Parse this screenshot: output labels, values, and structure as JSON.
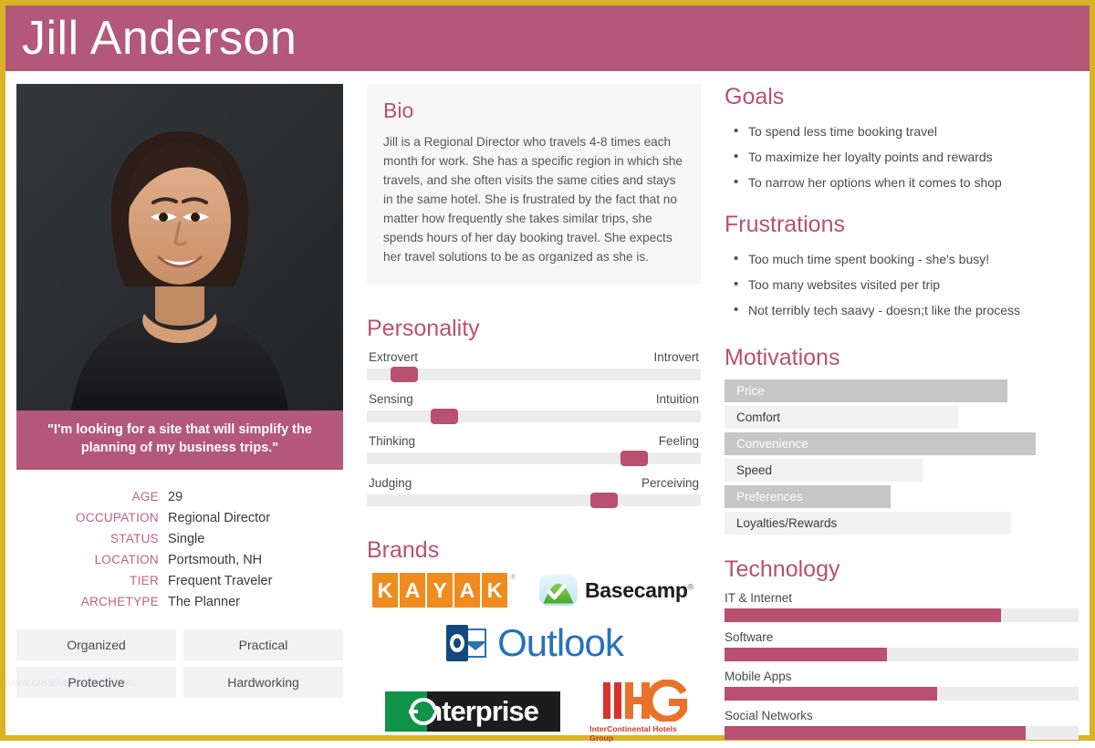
{
  "theme": {
    "accent": "#b9506f",
    "header_bg": "#b35878",
    "border": "#d9b225",
    "bar_fill": "#b9506f",
    "track": "#ececec"
  },
  "header": {
    "title": "Jill Anderson"
  },
  "photo": {
    "alt": "portrait-photo",
    "quote": "\"I'm looking for a site that will simplify the planning of my business trips.\""
  },
  "attributes": [
    {
      "key": "AGE",
      "value": "29"
    },
    {
      "key": "OCCUPATION",
      "value": "Regional Director"
    },
    {
      "key": "STATUS",
      "value": "Single"
    },
    {
      "key": "LOCATION",
      "value": "Portsmouth, NH"
    },
    {
      "key": "TIER",
      "value": "Frequent Traveler"
    },
    {
      "key": "ARCHETYPE",
      "value": "The Planner"
    }
  ],
  "traits": [
    "Organized",
    "Practical",
    "Protective",
    "Hardworking"
  ],
  "bio": {
    "title": "Bio",
    "text": "Jill is a Regional Director who travels 4-8 times each month for work. She has a specific region in which she travels, and she often visits the same cities and stays in the same hotel. She is frustrated by the fact that no matter how frequently she takes similar trips, she spends hours of her day booking travel. She expects her travel solutions to be as organized as she is."
  },
  "personality": {
    "title": "Personality",
    "sliders": [
      {
        "left": "Extrovert",
        "right": "Introvert",
        "position": 7
      },
      {
        "left": "Sensing",
        "right": "Intuition",
        "position": 19
      },
      {
        "left": "Thinking",
        "right": "Feeling",
        "position": 76
      },
      {
        "left": "Judging",
        "right": "Perceiving",
        "position": 67
      }
    ]
  },
  "brands": {
    "title": "Brands",
    "items": [
      {
        "name": "KAYAK",
        "letters": [
          "K",
          "A",
          "Y",
          "A",
          "K"
        ],
        "registered": "®"
      },
      {
        "name": "Basecamp",
        "registered": "®"
      },
      {
        "name": "Outlook"
      },
      {
        "name": "enterprise"
      },
      {
        "name": "IHG",
        "subtitle": "InterContinental Hotels Group"
      }
    ]
  },
  "goals": {
    "title": "Goals",
    "items": [
      "To spend less time booking travel",
      "To maximize her loyalty points and rewards",
      "To narrow her options when it comes to shop"
    ]
  },
  "frustrations": {
    "title": "Frustrations",
    "items": [
      "Too much time spent booking - she's busy!",
      "Too many websites visited per trip",
      "Not terribly tech saavy - doesn;t like the process"
    ]
  },
  "motivations": {
    "title": "Motivations",
    "items": [
      {
        "label": "Price",
        "value": 92,
        "style": "dark"
      },
      {
        "label": "Comfort",
        "value": 77,
        "style": "light"
      },
      {
        "label": "Convenience",
        "value": 100,
        "style": "dark"
      },
      {
        "label": "Speed",
        "value": 66,
        "style": "light"
      },
      {
        "label": "Preferences",
        "value": 54,
        "style": "dark"
      },
      {
        "label": "Loyalties/Rewards",
        "value": 94,
        "style": "light"
      }
    ]
  },
  "technology": {
    "title": "Technology",
    "items": [
      {
        "label": "IT & Internet",
        "value": 78
      },
      {
        "label": "Software",
        "value": 46
      },
      {
        "label": "Mobile Apps",
        "value": 60
      },
      {
        "label": "Social Networks",
        "value": 85
      }
    ]
  }
}
